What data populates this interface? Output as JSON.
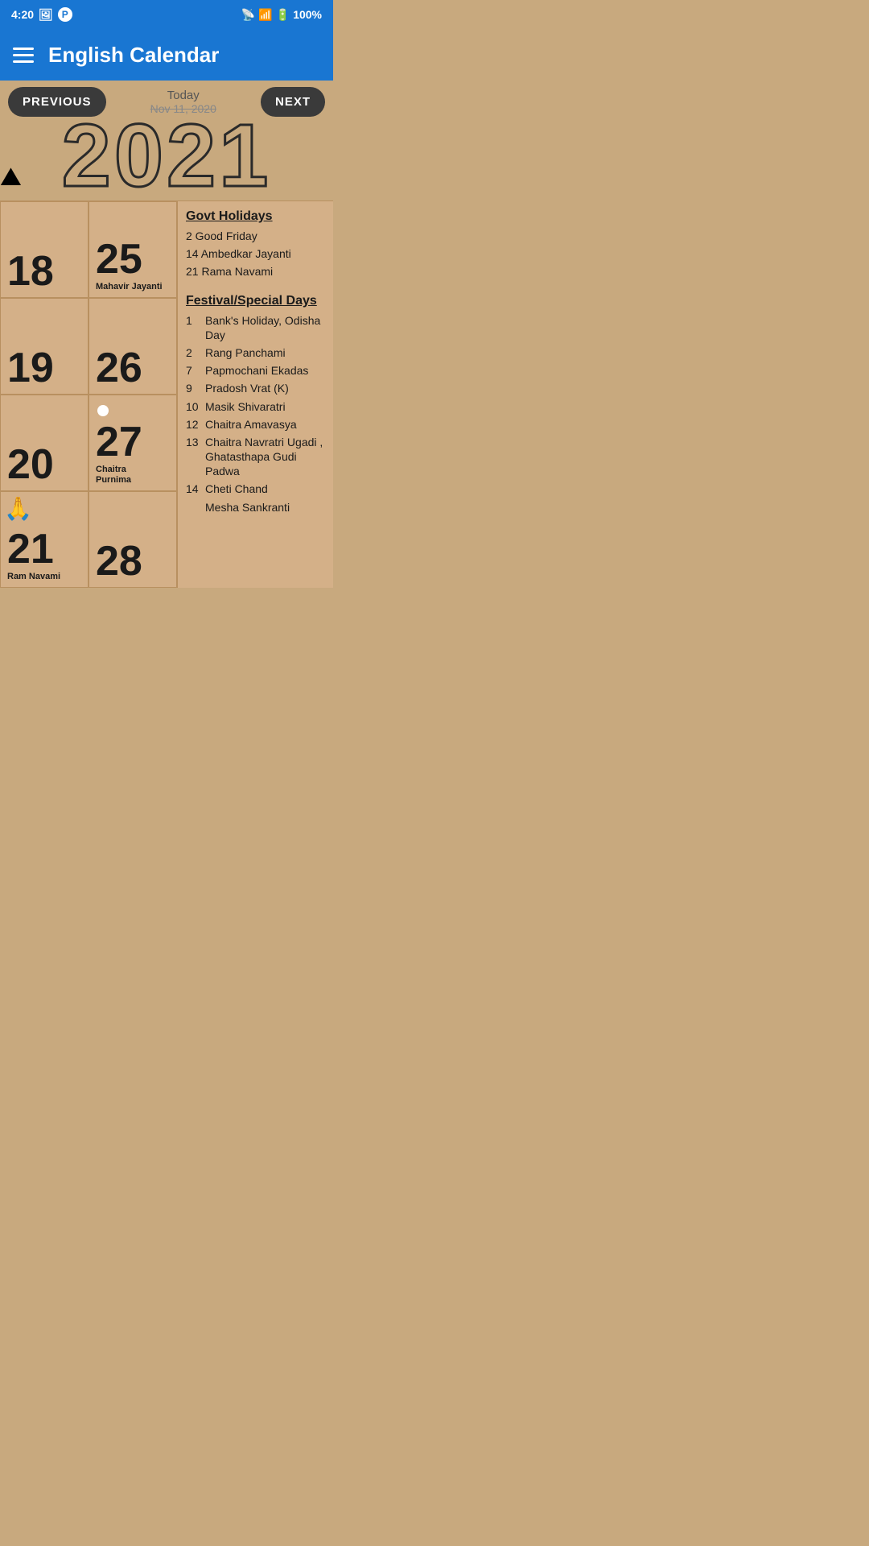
{
  "statusBar": {
    "time": "4:20",
    "battery": "100%"
  },
  "header": {
    "title": "English Calendar",
    "menuLabel": "menu"
  },
  "navigation": {
    "prevLabel": "PREVIOUS",
    "nextLabel": "NEXT",
    "todayLabel": "Today",
    "currentDate": "Nov 11, 2020",
    "year": "2021"
  },
  "calendarCells": [
    {
      "day": "18",
      "event": "",
      "dot": false,
      "image": false
    },
    {
      "day": "25",
      "event": "Mahavir Jayanti",
      "dot": false,
      "image": false
    },
    {
      "day": "19",
      "event": "",
      "dot": false,
      "image": false
    },
    {
      "day": "26",
      "event": "",
      "dot": false,
      "image": false
    },
    {
      "day": "20",
      "event": "",
      "dot": false,
      "image": false
    },
    {
      "day": "27",
      "event": "Chaitra\nPurnima",
      "dot": true,
      "image": false
    },
    {
      "day": "21",
      "event": "Ram Navami",
      "dot": false,
      "image": true
    },
    {
      "day": "28",
      "event": "",
      "dot": false,
      "image": false
    }
  ],
  "govtHolidays": {
    "title": "Govt Holidays",
    "items": [
      {
        "date": "2",
        "name": "Good Friday"
      },
      {
        "date": "14",
        "name": "Ambedkar Jayanti"
      },
      {
        "date": "21",
        "name": "Rama Navami"
      }
    ]
  },
  "festivals": {
    "title": "Festival/Special Days",
    "items": [
      {
        "date": "1",
        "name": "Bank's Holiday, Odisha Day"
      },
      {
        "date": "2",
        "name": "Rang Panchami"
      },
      {
        "date": "7",
        "name": "Papmochani Ekadas"
      },
      {
        "date": "9",
        "name": "Pradosh Vrat (K)"
      },
      {
        "date": "10",
        "name": "Masik Shivaratri"
      },
      {
        "date": "12",
        "name": "Chaitra Amavasya"
      },
      {
        "date": "13",
        "name": "Chaitra Navratri Ugadi , Ghatasthapa Gudi Padwa"
      },
      {
        "date": "14",
        "name": "Cheti Chand"
      },
      {
        "date": "",
        "name": "Mesha Sankranti"
      }
    ]
  }
}
